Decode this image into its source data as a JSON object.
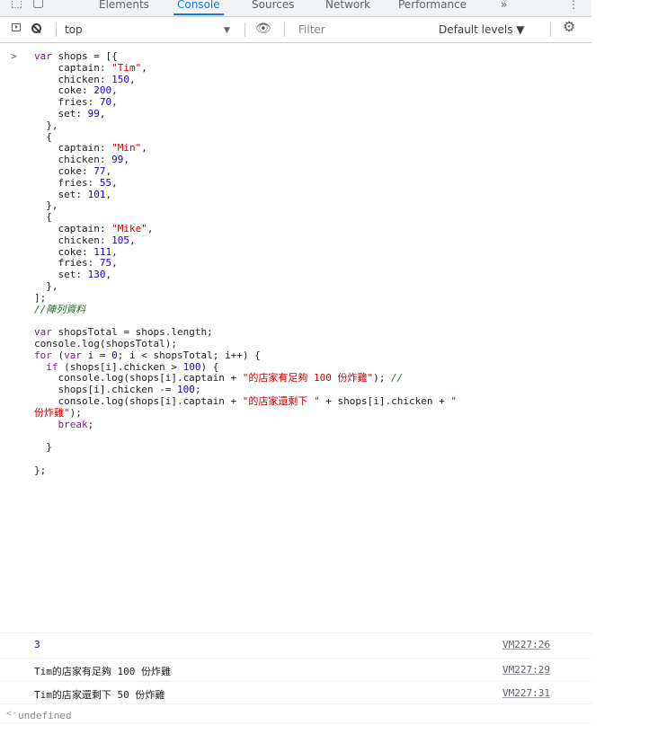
{
  "tabbar": {
    "tabs": [
      "Elements",
      "Console",
      "Sources",
      "Network",
      "Performance"
    ],
    "active": "Console",
    "more": "»",
    "menu": "⋮"
  },
  "toolbar": {
    "context": "top",
    "filter_placeholder": "Filter",
    "levels": "Default levels ▼"
  },
  "console": {
    "prompt": ">",
    "input_code": [
      "var shops = [{",
      "    captain: \"Tim\",",
      "    chicken: 150,",
      "    coke: 200,",
      "    fries: 70,",
      "    set: 99,",
      "  },",
      "  {",
      "    captain: \"Min\",",
      "    chicken: 99,",
      "    coke: 77,",
      "    fries: 55,",
      "    set: 101,",
      "  },",
      "  {",
      "    captain: \"Mike\",",
      "    chicken: 105,",
      "    coke: 111,",
      "    fries: 75,",
      "    set: 130,",
      "  },",
      "];",
      "//陣列資料",
      "",
      "var shopsTotal = shops.length;",
      "console.log(shopsTotal);",
      "for (var i = 0; i < shopsTotal; i++) {",
      "  if (shops[i].chicken > 100) {",
      "    console.log(shops[i].captain + \"的店家有足夠 100 份炸雞\"); //",
      "    shops[i].chicken -= 100;",
      "    console.log(shops[i].captain + \"的店家還剩下 \" + shops[i].chicken + \"",
      "份炸雞\");",
      "    break;",
      "",
      "  }",
      "",
      "};"
    ],
    "logs": [
      {
        "message": "3",
        "source": "VM227:26"
      },
      {
        "message": "Tim的店家有足夠 100 份炸雞",
        "source": "VM227:29"
      },
      {
        "message": "Tim的店家還剩下 50 份炸雞",
        "source": "VM227:31"
      }
    ],
    "return_arrow": "<·",
    "return_value": "undefined"
  }
}
